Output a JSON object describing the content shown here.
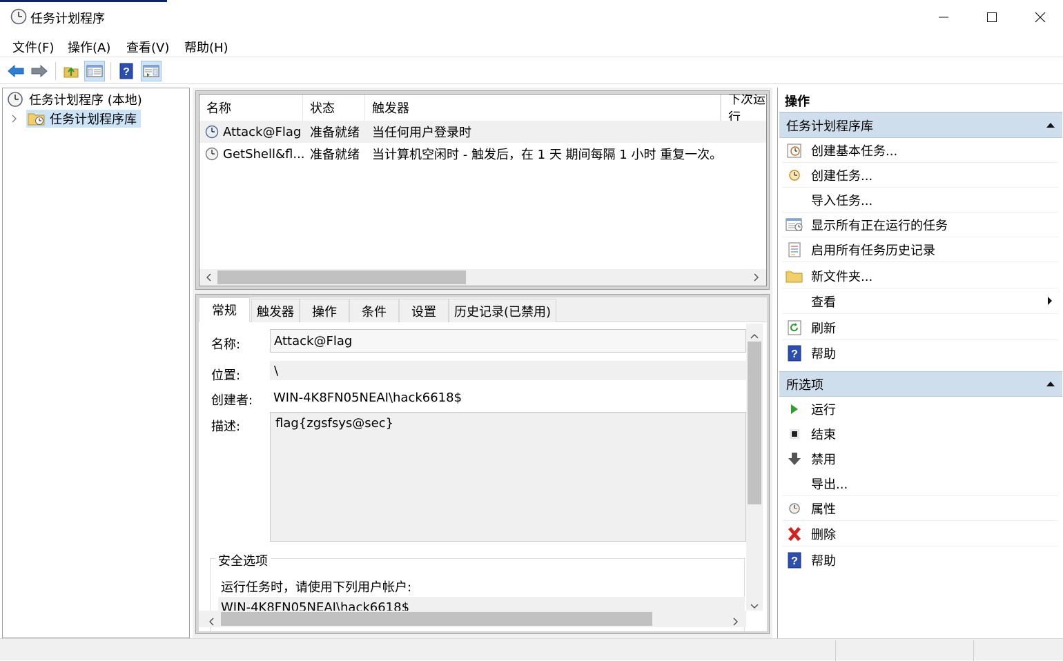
{
  "window": {
    "title": "任务计划程序"
  },
  "menu": [
    "文件(F)",
    "操作(A)",
    "查看(V)",
    "帮助(H)"
  ],
  "tree": {
    "root": "任务计划程序 (本地)",
    "library": "任务计划程序库"
  },
  "task_list": {
    "columns": [
      "名称",
      "状态",
      "触发器",
      "下次运行"
    ],
    "rows": [
      {
        "name": "Attack@Flag",
        "status": "准备就绪",
        "trigger": "当任何用户登录时"
      },
      {
        "name": "GetShell&fl...",
        "status": "准备就绪",
        "trigger": "当计算机空闲时 - 触发后，在 1 天 期间每隔 1 小时 重复一次。"
      }
    ]
  },
  "detail": {
    "tabs": [
      "常规",
      "触发器",
      "操作",
      "条件",
      "设置",
      "历史记录(已禁用)"
    ],
    "name_label": "名称:",
    "name_value": "Attack@Flag",
    "location_label": "位置:",
    "location_value": "\\",
    "author_label": "创建者:",
    "author_value": "WIN-4K8FN05NEAI\\hack6618$",
    "description_label": "描述:",
    "description_value": "flag{zgsfsys@sec}",
    "security_group": "安全选项",
    "run_as_prompt": "运行任务时，请使用下列用户帐户:",
    "run_as_user": "WIN-4K8FN05NEAI\\hack6618$"
  },
  "actions": {
    "header": "操作",
    "section1": {
      "title": "任务计划程序库",
      "items": [
        {
          "label": "创建基本任务...",
          "icon": "create-basic-task-icon"
        },
        {
          "label": "创建任务...",
          "icon": "create-task-icon"
        },
        {
          "label": "导入任务...",
          "icon": ""
        },
        {
          "label": "显示所有正在运行的任务",
          "icon": "running-tasks-icon"
        },
        {
          "label": "启用所有任务历史记录",
          "icon": "history-icon"
        },
        {
          "label": "新文件夹...",
          "icon": "new-folder-icon"
        },
        {
          "label": "查看",
          "icon": ""
        },
        {
          "label": "刷新",
          "icon": "refresh-icon"
        },
        {
          "label": "帮助",
          "icon": "help-icon"
        }
      ]
    },
    "section2": {
      "title": "所选项",
      "items": [
        {
          "label": "运行",
          "icon": "run-icon"
        },
        {
          "label": "结束",
          "icon": "stop-icon"
        },
        {
          "label": "禁用",
          "icon": "disable-icon"
        },
        {
          "label": "导出...",
          "icon": ""
        },
        {
          "label": "属性",
          "icon": "properties-icon"
        },
        {
          "label": "删除",
          "icon": "delete-icon"
        },
        {
          "label": "帮助",
          "icon": "help-icon"
        }
      ]
    }
  }
}
